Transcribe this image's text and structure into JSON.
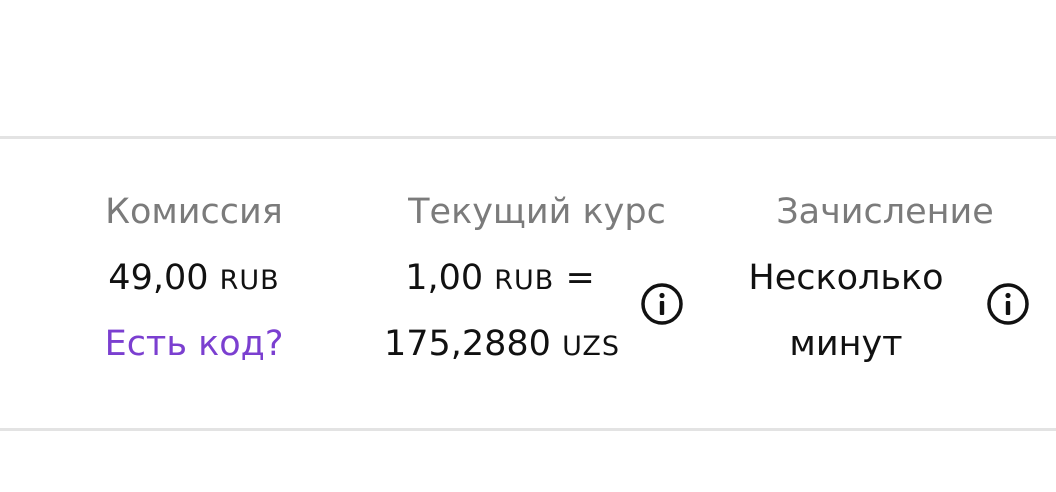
{
  "commission": {
    "label": "Комиссия",
    "amount": "49,00",
    "currency": "RUB",
    "promo_link": "Есть код?"
  },
  "rate": {
    "label": "Текущий курс",
    "from_amount": "1,00",
    "from_currency": "RUB",
    "equals": "=",
    "to_amount": "175,2880",
    "to_currency": "UZS",
    "icon": "info-icon"
  },
  "crediting": {
    "label": "Зачисление",
    "line1": "Несколько",
    "line2": "минут",
    "icon": "info-icon"
  },
  "colors": {
    "label_gray": "#7b7b7b",
    "text": "#111111",
    "link_purple": "#7b3fd0",
    "divider": "#e3e3e3"
  }
}
